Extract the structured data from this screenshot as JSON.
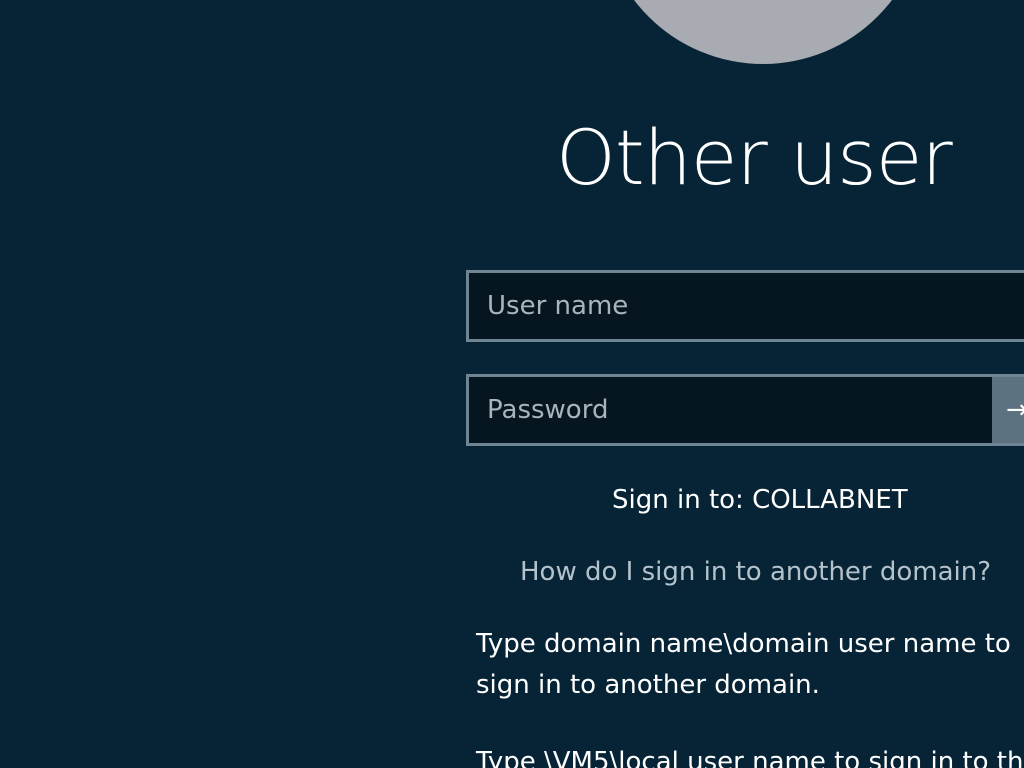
{
  "title": "Other user",
  "username_field": {
    "placeholder": "User name",
    "value": ""
  },
  "password_field": {
    "placeholder": "Password",
    "value": ""
  },
  "submit_icon": "→",
  "sign_in_to": "Sign in to: COLLABNET",
  "help_link": "How do I sign in to another domain?",
  "help_text": {
    "line1": "Type domain name\\domain user name to",
    "line2": "sign in to another domain."
  },
  "help_text2": "Type \\VM5\\local user name to sign in to th",
  "colors": {
    "background": "#072436",
    "avatar": "#a8acb2",
    "field_border": "#6f8594",
    "field_bg": "#061620",
    "submit_bg": "#5d7280",
    "link": "#b4c2cc"
  },
  "icons": {
    "avatar": "user-avatar",
    "submit": "arrow-right-icon"
  }
}
